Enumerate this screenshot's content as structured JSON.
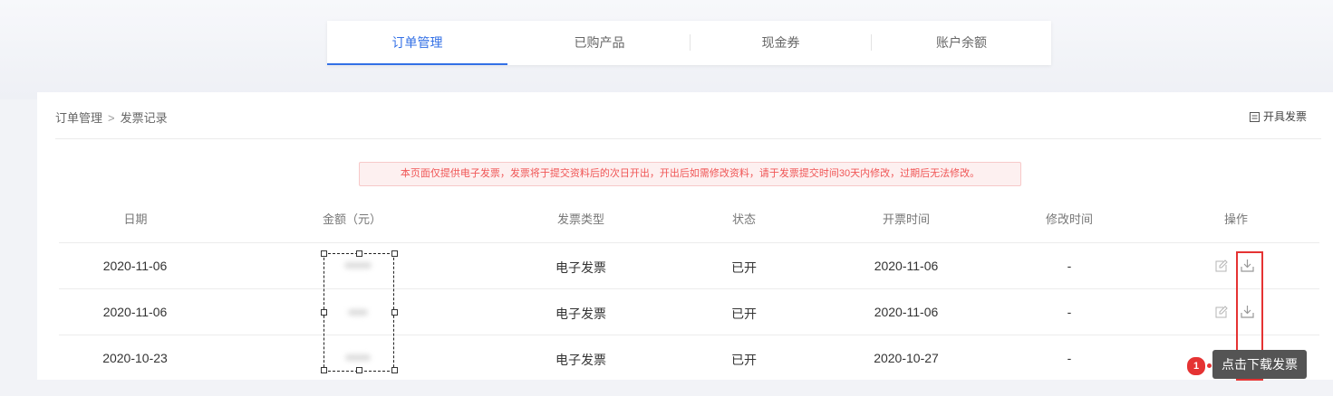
{
  "tabs": [
    {
      "label": "订单管理",
      "active": true
    },
    {
      "label": "已购产品",
      "active": false
    },
    {
      "label": "现金券",
      "active": false
    },
    {
      "label": "账户余额",
      "active": false
    }
  ],
  "breadcrumb": {
    "parent": "订单管理",
    "separator": ">",
    "current": "发票记录"
  },
  "issue_invoice_label": "开具发票",
  "notice": "本页面仅提供电子发票，发票将于提交资料后的次日开出，开出后如需修改资料，请于发票提交时间30天内修改，过期后无法修改。",
  "table": {
    "headers": [
      "日期",
      "金额（元）",
      "发票类型",
      "状态",
      "开票时间",
      "修改时间",
      "操作"
    ],
    "rows": [
      {
        "date": "2020-11-06",
        "amount": "",
        "type": "电子发票",
        "status": "已开",
        "issued": "2020-11-06",
        "modified": "-"
      },
      {
        "date": "2020-11-06",
        "amount": "",
        "type": "电子发票",
        "status": "已开",
        "issued": "2020-11-06",
        "modified": "-"
      },
      {
        "date": "2020-10-23",
        "amount": "",
        "type": "电子发票",
        "status": "已开",
        "issued": "2020-10-27",
        "modified": "-"
      }
    ]
  },
  "tooltip": {
    "step": "1",
    "text": "点击下载发票"
  },
  "colors": {
    "accent": "#3370e6",
    "highlight": "#e53333",
    "notice_text": "#f05656"
  }
}
